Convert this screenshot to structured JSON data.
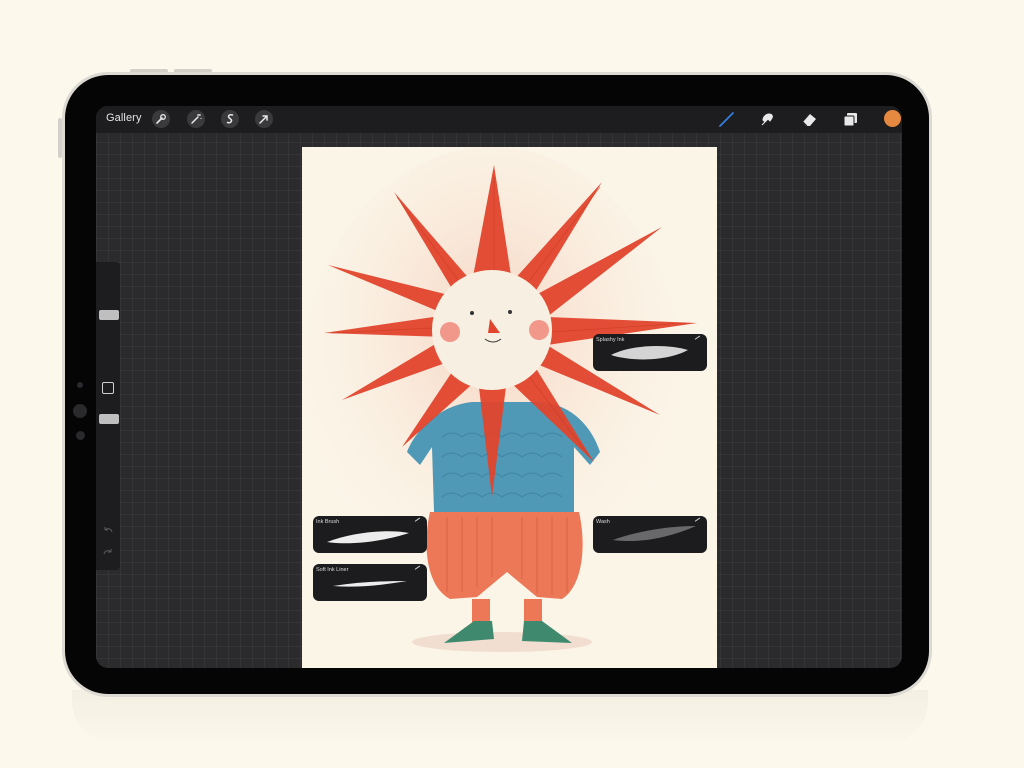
{
  "topbar": {
    "gallery_label": "Gallery",
    "left_tools": [
      {
        "name": "actions",
        "icon": "wrench-icon"
      },
      {
        "name": "adjustments",
        "icon": "magic-wand-icon"
      },
      {
        "name": "selection",
        "icon": "selection-s-icon"
      },
      {
        "name": "transform",
        "icon": "arrow-cursor-icon"
      }
    ],
    "right_tools": [
      {
        "name": "brush",
        "icon": "brush-icon",
        "active": true
      },
      {
        "name": "smudge",
        "icon": "smudge-icon"
      },
      {
        "name": "eraser",
        "icon": "eraser-icon"
      },
      {
        "name": "layers",
        "icon": "layers-icon"
      }
    ],
    "current_color": "#e58840",
    "active_color": "#2f7fe0"
  },
  "sidebar": {
    "brush_size_slider": {
      "icon": "slider-handle"
    },
    "opacity_slider": {
      "icon": "slider-handle"
    },
    "modify_button": {
      "icon": "square-icon"
    },
    "undo": {
      "icon": "undo-icon"
    },
    "redo": {
      "icon": "redo-icon"
    }
  },
  "brush_cards": [
    {
      "label": "Splashy Ink"
    },
    {
      "label": "Ink Brush"
    },
    {
      "label": "Wash"
    },
    {
      "label": "Soft Ink Liner"
    }
  ],
  "artwork": {
    "subject": "sun-headed character illustration",
    "colors": {
      "sun_rays": "#e2452d",
      "shirt": "#4f98b6",
      "pants": "#ec7857",
      "shoes": "#3f8a6e",
      "paper": "#fbf5e8"
    }
  }
}
